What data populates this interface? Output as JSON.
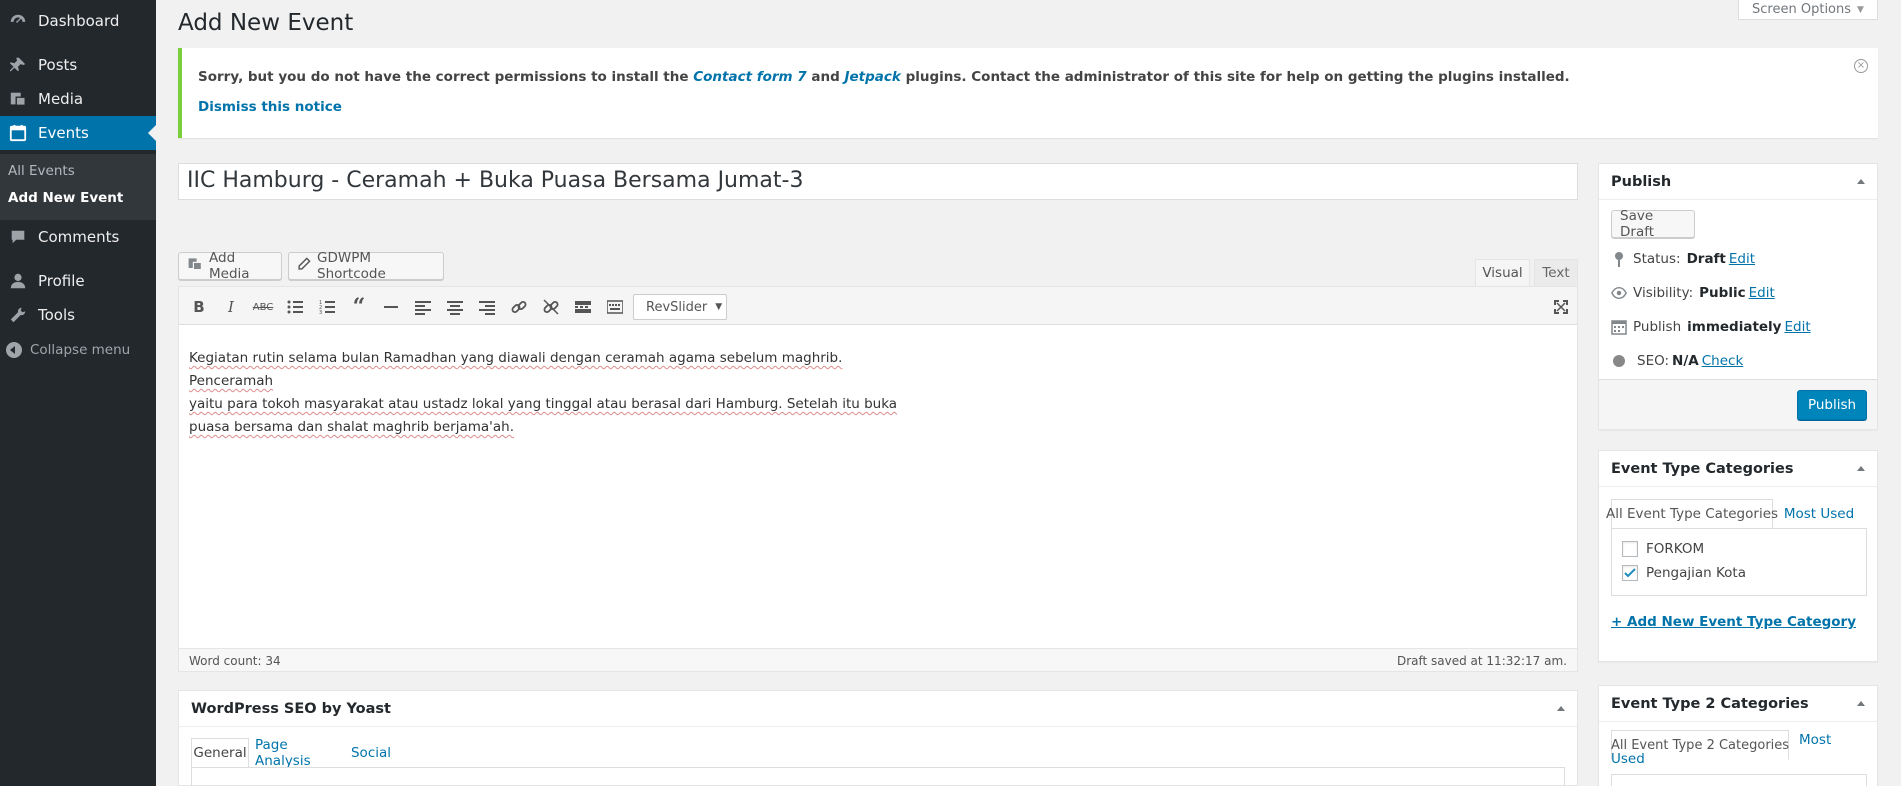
{
  "sidebar": {
    "items": [
      {
        "label": "Dashboard",
        "icon": "dashboard-icon"
      },
      {
        "label": "Posts",
        "icon": "pin-icon"
      },
      {
        "label": "Media",
        "icon": "media-icon"
      },
      {
        "label": "Events",
        "icon": "calendar-icon"
      },
      {
        "label": "Comments",
        "icon": "comment-icon"
      },
      {
        "label": "Profile",
        "icon": "user-icon"
      },
      {
        "label": "Tools",
        "icon": "wrench-icon"
      }
    ],
    "submenu": [
      "All Events",
      "Add New Event"
    ],
    "collapse_label": "Collapse menu"
  },
  "header": {
    "title": "Add New Event",
    "screen_options": "Screen Options"
  },
  "notice": {
    "text_before": "Sorry, but you do not have the correct permissions to install the ",
    "plugin_1": "Contact form 7",
    "text_and": " and ",
    "plugin_2": "Jetpack",
    "text_after": " plugins. Contact the administrator of this site for help on getting the plugins installed.",
    "dismiss": "Dismiss this notice",
    "accent": "#7ad03a"
  },
  "post": {
    "title": "IIC Hamburg - Ceramah + Buka Puasa Bersama Jumat-3"
  },
  "editor": {
    "add_media": "Add Media",
    "gdwpm_shortcode": "GDWPM Shortcode",
    "tab_visual": "Visual",
    "tab_text": "Text",
    "revslider": "RevSlider",
    "content_lines": [
      "Kegiatan rutin selama bulan Ramadhan yang diawali dengan ceramah agama sebelum maghrib. Penceramah",
      "yaitu para tokoh masyarakat atau ustadz lokal yang tinggal atau berasal dari Hamburg. Setelah itu buka",
      "puasa bersama dan shalat maghrib berjama'ah."
    ],
    "word_count": "Word count: 34",
    "draft_saved": "Draft saved at 11:32:17 am."
  },
  "yoast": {
    "title": "WordPress SEO by Yoast",
    "tabs": [
      "General",
      "Page Analysis",
      "Social"
    ]
  },
  "publish": {
    "title": "Publish",
    "save_draft": "Save Draft",
    "status_label": "Status:",
    "status_value": "Draft",
    "visibility_label": "Visibility:",
    "visibility_value": "Public",
    "publish_label": "Publish",
    "publish_value": "immediately",
    "edit": "Edit",
    "seo_label": "SEO:",
    "seo_value": "N/A",
    "seo_check": "Check",
    "publish_button": "Publish",
    "accent": "#0085ba"
  },
  "event_type_categories": {
    "title": "Event Type Categories",
    "tab_all": "All Event Type Categories",
    "tab_most_used": "Most Used",
    "items": [
      {
        "label": "FORKOM",
        "checked": false
      },
      {
        "label": "Pengajian Kota",
        "checked": true
      }
    ],
    "add_link": "+ Add New Event Type Category"
  },
  "event_type_2_categories": {
    "title": "Event Type 2 Categories",
    "tab_all": "All Event Type 2 Categories",
    "tab_most_used_1": "Most",
    "tab_most_used_2": "Used"
  }
}
